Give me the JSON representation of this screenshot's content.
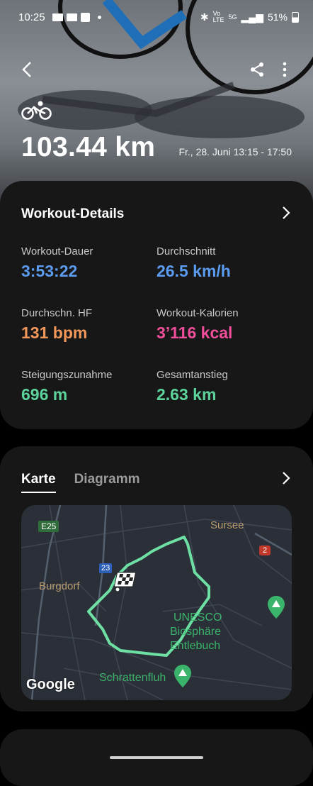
{
  "status_bar": {
    "time": "10:25",
    "battery": "51%"
  },
  "hero": {
    "distance": "103.44 km",
    "date": "Fr., 28. Juni 13:15 - 17:50"
  },
  "workout_details": {
    "title": "Workout-Details",
    "metrics": [
      {
        "label": "Workout-Dauer",
        "value": "3:53:22",
        "color": "#5b9cf0"
      },
      {
        "label": "Durchschnitt",
        "value": "26.5 km/h",
        "color": "#5b9cf0"
      },
      {
        "label": "Durchschn. HF",
        "value": "131 bpm",
        "color": "#f2975a"
      },
      {
        "label": "Workout-Kalorien",
        "value": "3’116 kcal",
        "color": "#ef4f9a"
      },
      {
        "label": "Steigungszunahme",
        "value": "696 m",
        "color": "#5cd39a"
      },
      {
        "label": "Gesamtanstieg",
        "value": "2.63 km",
        "color": "#5cd39a"
      }
    ]
  },
  "map_card": {
    "tabs": [
      "Karte",
      "Diagramm"
    ],
    "labels": {
      "e25": "E25",
      "sursee": "Sursee",
      "road2": "2",
      "road23": "23",
      "burgdorf": "Burgdorf",
      "unesco1": "UNESCO",
      "unesco2": "Biosphäre",
      "unesco3": "Entlebuch",
      "schrattenfluh": "Schrattenfluh",
      "google": "Google"
    }
  }
}
